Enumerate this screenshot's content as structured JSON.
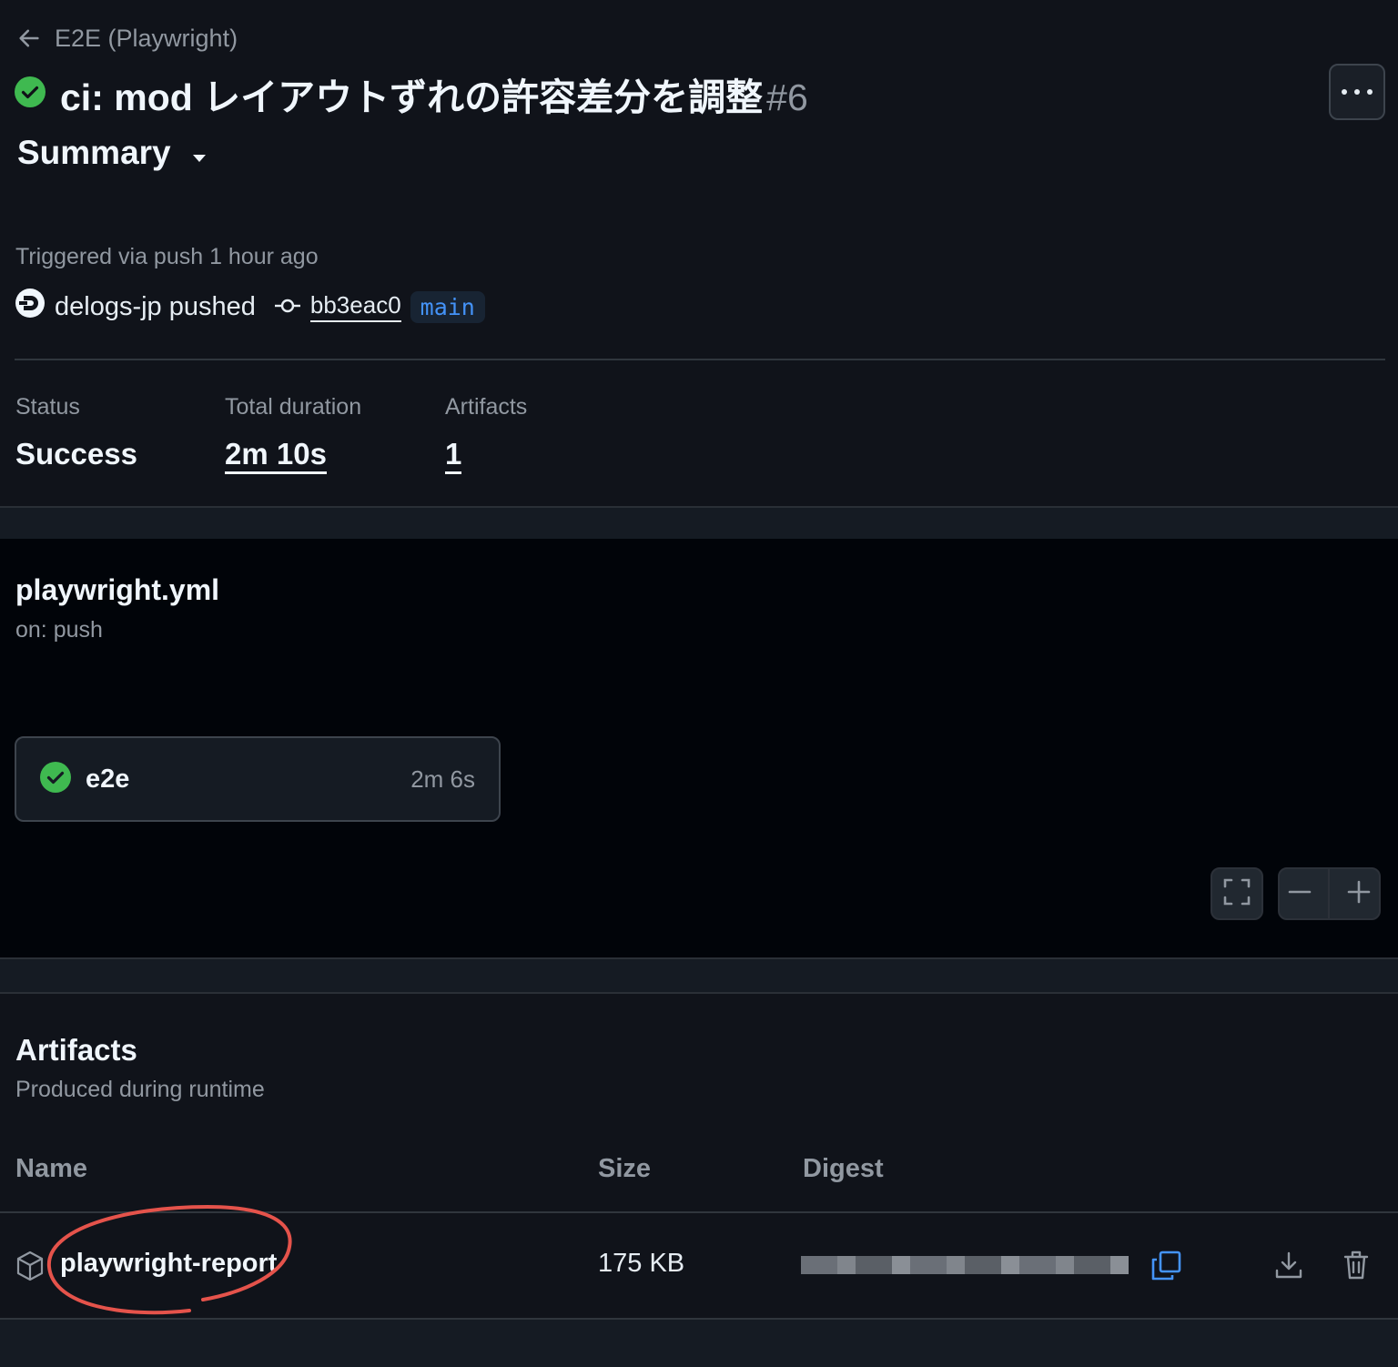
{
  "header": {
    "back_label": "E2E (Playwright)",
    "title": "ci: mod レイアウトずれの許容差分を調整",
    "run_number": "#6",
    "summary_label": "Summary"
  },
  "trigger": {
    "triggered_text": "Triggered via push 1 hour ago",
    "pusher_text": "delogs-jp pushed",
    "commit_sha": "bb3eac0",
    "branch": "main"
  },
  "stats": {
    "status_label": "Status",
    "status_value": "Success",
    "duration_label": "Total duration",
    "duration_value": "2m 10s",
    "artifacts_label": "Artifacts",
    "artifacts_value": "1"
  },
  "workflow": {
    "file_name": "playwright.yml",
    "trigger_text": "on: push",
    "job": {
      "name": "e2e",
      "duration": "2m 6s"
    }
  },
  "artifacts": {
    "title": "Artifacts",
    "subtitle": "Produced during runtime",
    "columns": {
      "name": "Name",
      "size": "Size",
      "digest": "Digest"
    },
    "rows": [
      {
        "name": "playwright-report",
        "size": "175 KB"
      }
    ]
  },
  "colors": {
    "success": "#3fb950",
    "link": "#4493f8",
    "annotation": "#e5534b"
  },
  "icons": [
    "arrow-left-icon",
    "check-circle-icon",
    "kebab-icon",
    "triangle-down-icon",
    "avatar-icon",
    "git-commit-icon",
    "fullscreen-icon",
    "minus-icon",
    "plus-icon",
    "package-icon",
    "copy-icon",
    "download-icon",
    "trash-icon"
  ]
}
